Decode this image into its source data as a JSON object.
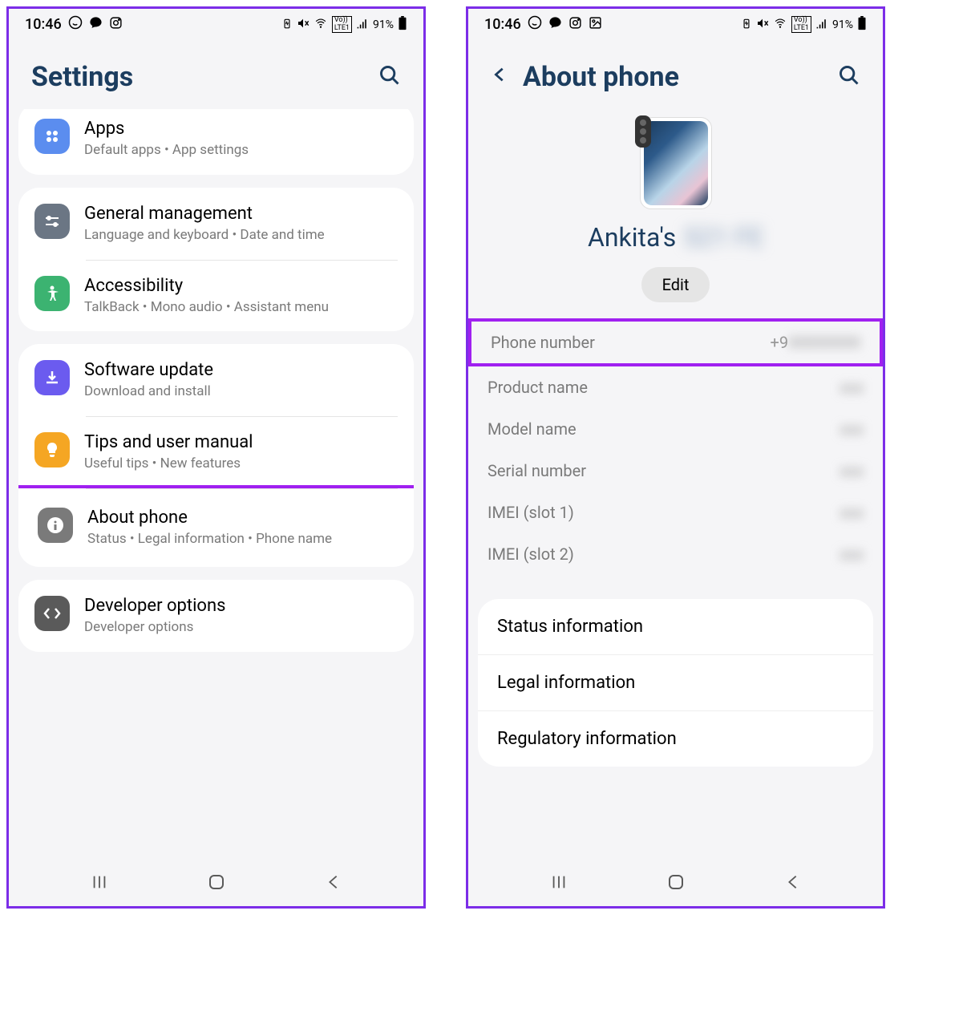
{
  "status": {
    "time": "10:46",
    "battery": "91%"
  },
  "left": {
    "title": "Settings",
    "items": [
      {
        "icon": "apps",
        "color": "#5b8def",
        "title": "Apps",
        "sub": "Default apps  •  App settings"
      },
      {
        "icon": "general",
        "color": "#6b7684",
        "title": "General management",
        "sub": "Language and keyboard  •  Date and time"
      },
      {
        "icon": "accessibility",
        "color": "#3cb371",
        "title": "Accessibility",
        "sub": "TalkBack  •  Mono audio  •  Assistant menu"
      },
      {
        "icon": "update",
        "color": "#6b5bef",
        "title": "Software update",
        "sub": "Download and install"
      },
      {
        "icon": "tips",
        "color": "#f5a623",
        "title": "Tips and user manual",
        "sub": "Useful tips  •  New features"
      },
      {
        "icon": "about",
        "color": "#7a7a7a",
        "title": "About phone",
        "sub": "Status  •  Legal information  •  Phone name"
      },
      {
        "icon": "dev",
        "color": "#5a5a5a",
        "title": "Developer options",
        "sub": "Developer options"
      }
    ]
  },
  "right": {
    "title": "About phone",
    "device_name": "Ankita's",
    "device_name_hidden": "S21 FE",
    "edit": "Edit",
    "info": [
      {
        "label": "Phone number",
        "value": "+9",
        "hidden": true,
        "highlight": true
      },
      {
        "label": "Product name",
        "value": "",
        "hidden": true
      },
      {
        "label": "Model name",
        "value": "",
        "hidden": true
      },
      {
        "label": "Serial number",
        "value": "",
        "hidden": true
      },
      {
        "label": "IMEI (slot 1)",
        "value": "",
        "hidden": true
      },
      {
        "label": "IMEI (slot 2)",
        "value": "",
        "hidden": true
      }
    ],
    "links": [
      "Status information",
      "Legal information",
      "Regulatory information"
    ]
  }
}
